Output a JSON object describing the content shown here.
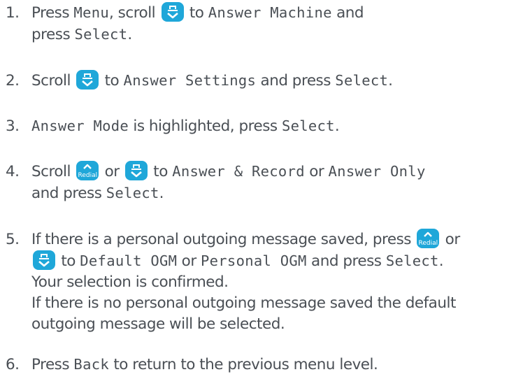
{
  "colors": {
    "text": "#4a4f55",
    "key_background": "#1fa7d9",
    "key_icon": "#ffffff"
  },
  "icons": {
    "down_key": "phonebook-down-key-icon",
    "up_key": "redial-up-key-icon"
  },
  "up_key_label": "Redial",
  "steps": [
    {
      "number": "1.",
      "lines": [
        {
          "t1": "Press ",
          "menu": "Menu",
          "t2": ", scroll ",
          "t3": " to ",
          "target": "Answer Machine",
          "t4": " and"
        },
        {
          "t1": "press ",
          "select": "Select",
          "t2": "."
        }
      ]
    },
    {
      "number": "2.",
      "lines": [
        {
          "t1": "Scroll ",
          "t2": " to ",
          "target": "Answer Settings",
          "t3": " and press ",
          "select": "Select",
          "t4": "."
        }
      ]
    },
    {
      "number": "3.",
      "lines": [
        {
          "target": "Answer Mode",
          "t1": " is highlighted, press ",
          "select": "Select",
          "t2": "."
        }
      ]
    },
    {
      "number": "4.",
      "lines": [
        {
          "t1": "Scroll ",
          "t2": " or ",
          "t3": " to ",
          "opt1": "Answer & Record",
          "t4": " or ",
          "opt2": "Answer Only"
        },
        {
          "t1": "and press ",
          "select": "Select",
          "t2": "."
        }
      ]
    },
    {
      "number": "5.",
      "lines": [
        {
          "t1": "If there is a personal outgoing message saved, press ",
          "t2": " or"
        },
        {
          "t1": " to ",
          "opt1": "Default OGM",
          "t2": " or ",
          "opt2": "Personal OGM",
          "t3": " and press ",
          "select": "Select",
          "t4": "."
        },
        {
          "t1": "Your selection is confirmed."
        },
        {
          "t1": "If there is no personal outgoing message saved the default"
        },
        {
          "t1": "outgoing message will be selected."
        }
      ]
    },
    {
      "number": "6.",
      "lines": [
        {
          "t1": "Press ",
          "back": "Back",
          "t2": " to return to the previous menu level."
        }
      ]
    }
  ]
}
